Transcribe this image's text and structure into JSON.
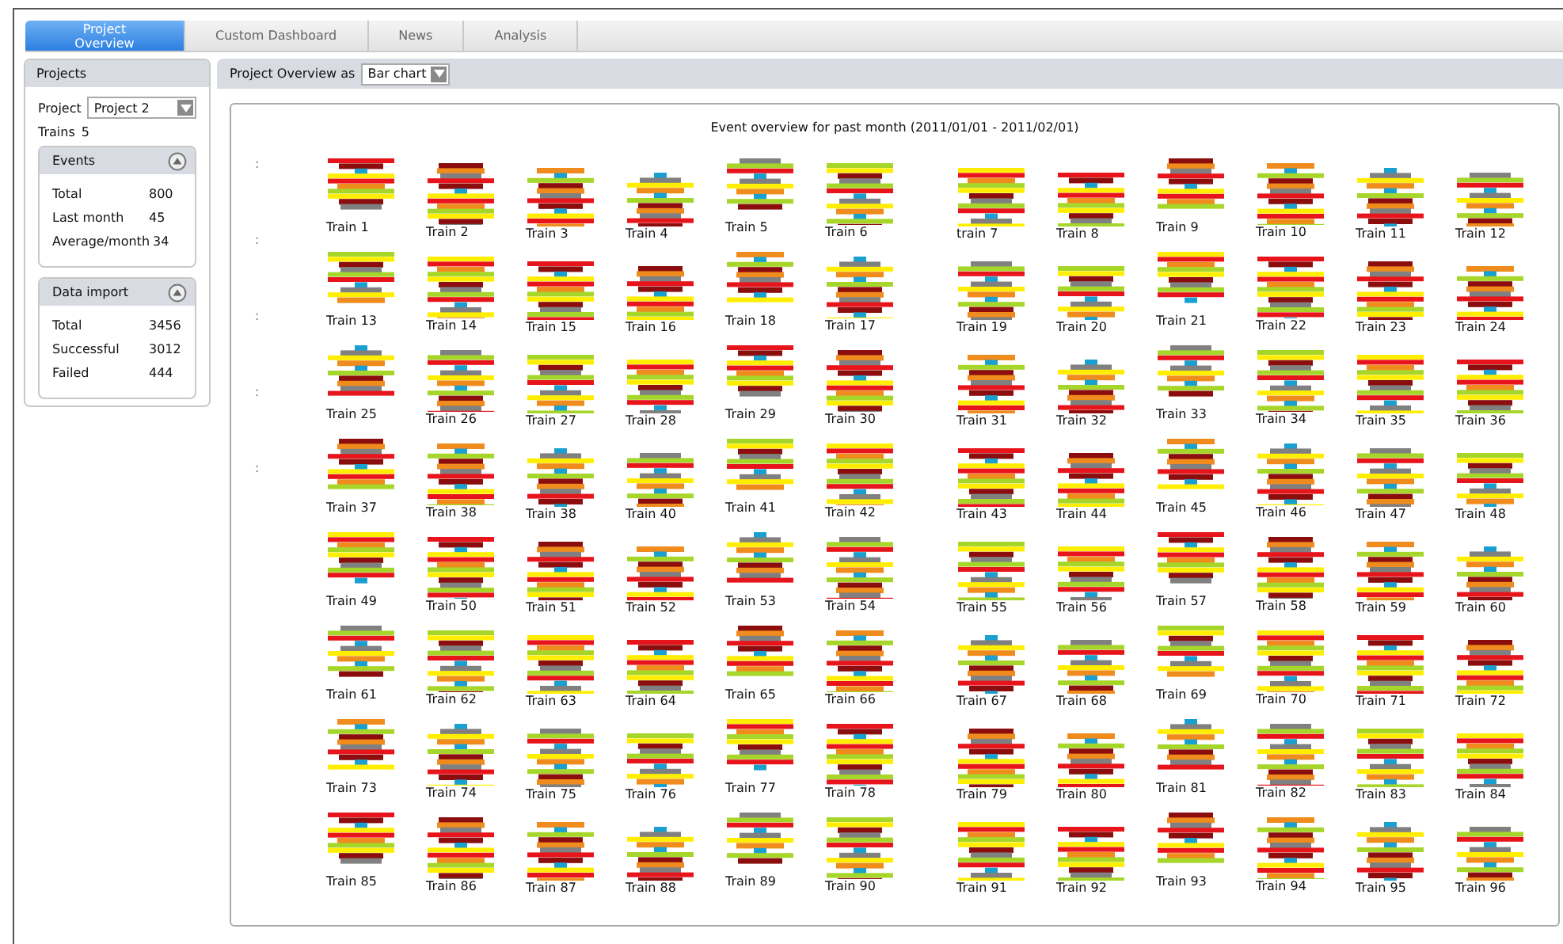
{
  "tabs": [
    {
      "label": "Project Overview",
      "selected": true
    },
    {
      "label": "Custom Dashboard",
      "selected": false
    },
    {
      "label": "News",
      "selected": false
    },
    {
      "label": "Analysis",
      "selected": false
    }
  ],
  "sidebar": {
    "title": "Projects",
    "project_label": "Project",
    "project_value": "Project 2",
    "trains_label": "Trains",
    "trains_value": "5",
    "sections": [
      {
        "title": "Events",
        "expanded": true,
        "rows": [
          {
            "label": "Total",
            "value": "800"
          },
          {
            "label": "Last month",
            "value": "45"
          },
          {
            "label": "Average/month",
            "value": "34"
          }
        ]
      },
      {
        "title": "Data import",
        "expanded": true,
        "rows": [
          {
            "label": "Total",
            "value": "3456"
          },
          {
            "label": "Successful",
            "value": "3012"
          },
          {
            "label": "Failed",
            "value": "444"
          }
        ]
      }
    ]
  },
  "toolbar": {
    "label": "Project Overview as",
    "view_value": "Bar chart"
  },
  "chart": {
    "title": "Event overview for past month (2011/01/01 - 2011/02/01)",
    "row_marks": [
      ":",
      ":",
      ":",
      ":",
      ":"
    ],
    "trains": [
      "Train 1",
      "Train 2",
      "Train 3",
      "Train 4",
      "Train 5",
      "Train 6",
      "train 7",
      "Train 8",
      "Train 9",
      "Train 10",
      "Train 11",
      "Train 12",
      "Train 13",
      "Train 14",
      "Train 15",
      "Train 16",
      "Train 18",
      "Train 17",
      "Train 19",
      "Train 20",
      "Train 21",
      "Train 22",
      "Train 23",
      "Train 24",
      "Train 25",
      "Train 26",
      "Train 27",
      "Train 28",
      "Train 29",
      "Train 30",
      "Train 31",
      "Train 32",
      "Train 33",
      "Train 34",
      "Train 35",
      "Train 36",
      "Train 37",
      "Train 38",
      "Train 38",
      "Train 40",
      "Train 41",
      "Train 42",
      "Train 43",
      "Train 44",
      "Train 45",
      "Train 46",
      "Train 47",
      "Train 48",
      "Train 49",
      "Train 50",
      "Train 51",
      "Train 52",
      "Train 53",
      "Train 54",
      "Train 55",
      "Train 56",
      "Train 57",
      "Train 58",
      "Train 59",
      "Train 60",
      "Train 61",
      "Train 62",
      "Train 63",
      "Train 64",
      "Train 65",
      "Train 66",
      "Train 67",
      "Train 68",
      "Train 69",
      "Train 70",
      "Train 71",
      "Train 72",
      "Train 73",
      "Train 74",
      "Train 75",
      "Train 76",
      "Train 77",
      "Train 78",
      "Train 79",
      "Train 80",
      "Train 81",
      "Train 82",
      "Train 83",
      "Train 84",
      "Train 85",
      "Train 86",
      "Train 87",
      "Train 88",
      "Train 89",
      "Train 90",
      "Train 91",
      "Train 92",
      "Train 93",
      "Train 94",
      "Train 95",
      "Train 96"
    ]
  }
}
